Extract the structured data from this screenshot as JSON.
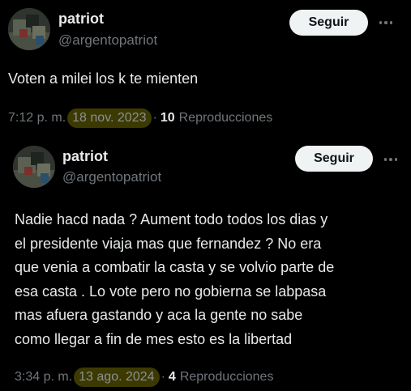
{
  "posts": [
    {
      "author_name": "patriot",
      "author_handle": "@argentopatriot",
      "follow_label": "Seguir",
      "text": "Voten a milei los k te mienten",
      "time": "7:12 p. m.",
      "sep1": "·",
      "date": "18 nov. 2023",
      "sep2": "·",
      "views_count": "10",
      "views_label": "Reproducciones"
    },
    {
      "author_name": "patriot",
      "author_handle": "@argentopatriot",
      "follow_label": "Seguir",
      "text_lines": [
        "Nadie hacd nada ? Aument todo todos los dias y",
        "el presidente viaja mas que fernandez ? No era",
        "que venia a combatir la casta y se volvio parte de",
        "esa casta . Lo vote pero no gobierna se labpasa",
        "mas afuera gastando y aca la gente no sabe",
        "como llegar a fin de mes esto es la libertad"
      ],
      "time": "3:34 p. m.",
      "sep1": "·",
      "date": "13 ago. 2024",
      "sep2": "·",
      "views_count": "4",
      "views_label": "Reproducciones"
    }
  ],
  "icons": {
    "avatar": "avatar-image",
    "more": "more-options-icon"
  },
  "colors": {
    "background": "#000000",
    "text_primary": "#e7e9ea",
    "text_secondary": "#71767b",
    "button_bg": "#eff3f4",
    "date_highlight": "#6e6900"
  }
}
